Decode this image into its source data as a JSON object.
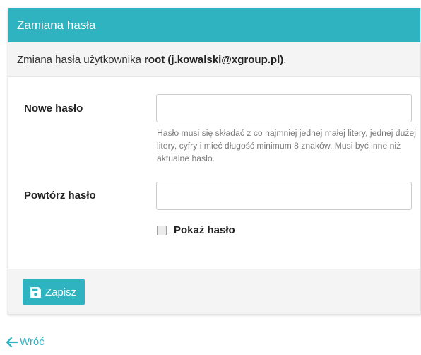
{
  "panel": {
    "title": "Zamiana hasła",
    "intro_prefix": "Zmiana hasła użytkownika ",
    "intro_user": "root (j.kowalski@xgroup.pl)",
    "intro_suffix": "."
  },
  "form": {
    "new_password_label": "Nowe hasło",
    "new_password_value": "",
    "new_password_hint": "Hasło musi się składać z co najmniej jednej małej litery, jednej dużej litery, cyfry i mieć długość minimum 8 znaków. Musi być inne niż aktualne hasło.",
    "repeat_password_label": "Powtórz hasło",
    "repeat_password_value": "",
    "show_password_label": "Pokaż hasło",
    "show_password_checked": false
  },
  "footer": {
    "save_label": "Zapisz",
    "save_icon": "floppy-disk-icon"
  },
  "nav": {
    "back_label": "Wróć",
    "back_icon": "arrow-left-icon"
  },
  "colors": {
    "accent": "#2fb3c1",
    "panel_bg": "#f4f4f4"
  }
}
